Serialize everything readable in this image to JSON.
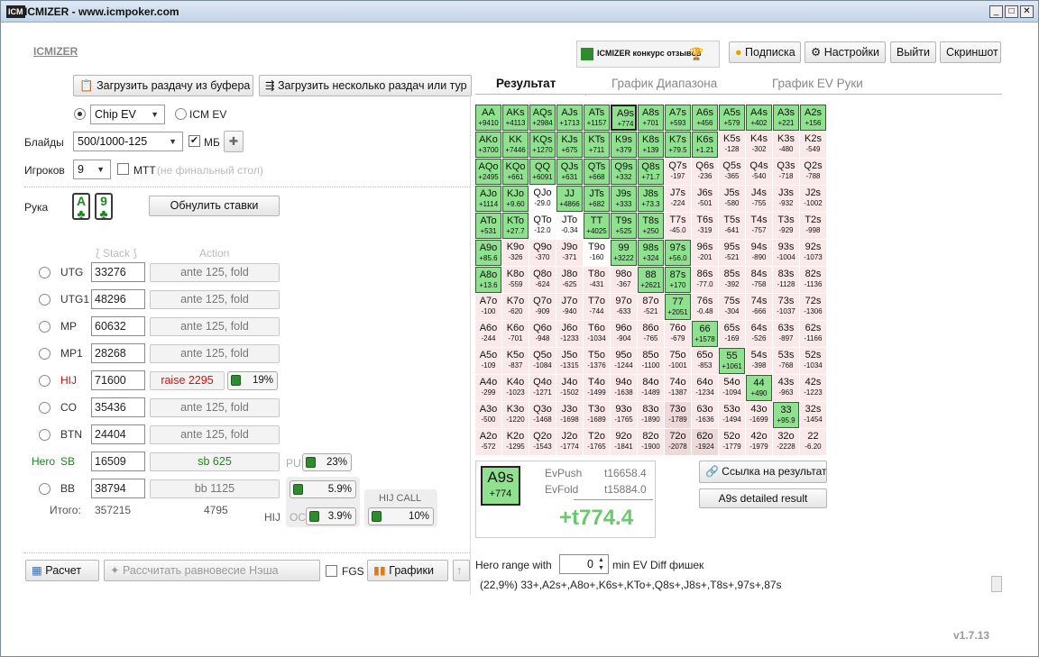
{
  "window": {
    "title": "ICMIZER - www.icmpoker.com",
    "icon_text": "ICM"
  },
  "header": {
    "brand": "ICMIZER",
    "promo": "ICMIZER конкурс отзывов",
    "subscribe": "Подписка",
    "settings": "Настройки",
    "exit": "Выйти",
    "screenshot": "Скриншот"
  },
  "load": {
    "from_clipboard": "Загрузить раздачу из буфера",
    "load_multiple": "Загрузить несколько раздач или тур"
  },
  "model": {
    "chip_ev": "Chip EV",
    "icm_ev": "ICM EV",
    "selected": "Chip EV"
  },
  "blinds": {
    "label": "Блайды",
    "value": "500/1000-125",
    "mb_label": "МБ"
  },
  "players": {
    "label": "Игроков",
    "value": "9",
    "mtt_label": "МТТ",
    "note": "(не финальный стол)"
  },
  "hand": {
    "label": "Рука",
    "card1": "A",
    "card2": "9",
    "reset": "Обнулить ставки"
  },
  "table_head": {
    "stack": "Stack",
    "action": "Action"
  },
  "seats": [
    {
      "pos": "UTG",
      "stack": "33276",
      "action": "ante 125, fold"
    },
    {
      "pos": "UTG1",
      "stack": "48296",
      "action": "ante 125, fold"
    },
    {
      "pos": "MP",
      "stack": "60632",
      "action": "ante 125, fold"
    },
    {
      "pos": "MP1",
      "stack": "28268",
      "action": "ante 125, fold"
    },
    {
      "pos": "HIJ",
      "stack": "71600",
      "action": "raise 2295",
      "pct": "19%"
    },
    {
      "pos": "CO",
      "stack": "35436",
      "action": "ante 125, fold"
    },
    {
      "pos": "BTN",
      "stack": "24404",
      "action": "ante 125, fold"
    },
    {
      "pos": "SB",
      "hero": "Hero",
      "stack": "16509",
      "action": "sb 625"
    },
    {
      "pos": "BB",
      "stack": "38794",
      "action": "bb 1125"
    }
  ],
  "totals": {
    "label": "Итого:",
    "stack": "357215",
    "pot": "4795"
  },
  "ranges": {
    "pu_label": "PU",
    "pu_pct": "23%",
    "bb_pct": "5.9%",
    "hij_label": "HIJ",
    "oc_label": "OC",
    "oc_pct": "3.9%",
    "hij_call_label": "HIJ CALL",
    "hij_call_pct": "10%"
  },
  "bottom": {
    "calc": "Расчет",
    "nash": "Рассчитать равновесие Нэша",
    "fgs": "FGS",
    "charts": "Графики"
  },
  "result": {
    "tab_result": "Результат",
    "tab_range": "График Диапазона",
    "tab_ev": "График EV Руки",
    "hand": "A9s",
    "hand_ev": "+774",
    "evpush_label": "EvPush",
    "evpush": "t16658.4",
    "evfold_label": "EvFold",
    "evfold": "t15884.0",
    "diff": "+t774.4",
    "link": "Ссылка на результат",
    "detail": "A9s detailed result",
    "range_with": "Hero range with",
    "min_ev": "0",
    "min_ev_label": "min EV Diff фишек",
    "range_text": "(22,9%) 33+,A2s+,A8o+,K6s+,KTo+,Q8s+,J8s+,T8s+,97s+,87s"
  },
  "version": "v1.7.13",
  "grid": [
    [
      [
        "AA",
        "+9410",
        "g"
      ],
      [
        "AKs",
        "+4113",
        "g"
      ],
      [
        "AQs",
        "+2984",
        "g"
      ],
      [
        "AJs",
        "+1713",
        "g"
      ],
      [
        "ATs",
        "+1157",
        "g"
      ],
      [
        "A9s",
        "+774",
        "gs"
      ],
      [
        "A8s",
        "+701",
        "g"
      ],
      [
        "A7s",
        "+593",
        "g"
      ],
      [
        "A6s",
        "+456",
        "g"
      ],
      [
        "A5s",
        "+579",
        "g"
      ],
      [
        "A4s",
        "+402",
        "g"
      ],
      [
        "A3s",
        "+221",
        "g"
      ],
      [
        "A2s",
        "+156",
        "g"
      ]
    ],
    [
      [
        "AKo",
        "+3700",
        "g"
      ],
      [
        "KK",
        "+7446",
        "g"
      ],
      [
        "KQs",
        "+1270",
        "g"
      ],
      [
        "KJs",
        "+675",
        "g"
      ],
      [
        "KTs",
        "+711",
        "g"
      ],
      [
        "K9s",
        "+379",
        "g"
      ],
      [
        "K8s",
        "+139",
        "g"
      ],
      [
        "K7s",
        "+79.5",
        "g"
      ],
      [
        "K6s",
        "+1.21",
        "g"
      ],
      [
        "K5s",
        "-128",
        "r"
      ],
      [
        "K4s",
        "-302",
        "r"
      ],
      [
        "K3s",
        "-480",
        "r"
      ],
      [
        "K2s",
        "-549",
        "r"
      ]
    ],
    [
      [
        "AQo",
        "+2495",
        "g"
      ],
      [
        "KQo",
        "+661",
        "g"
      ],
      [
        "QQ",
        "+6091",
        "g"
      ],
      [
        "QJs",
        "+631",
        "g"
      ],
      [
        "QTs",
        "+668",
        "g"
      ],
      [
        "Q9s",
        "+332",
        "g"
      ],
      [
        "Q8s",
        "+71.7",
        "g"
      ],
      [
        "Q7s",
        "-197",
        "r"
      ],
      [
        "Q6s",
        "-236",
        "r"
      ],
      [
        "Q5s",
        "-365",
        "r"
      ],
      [
        "Q4s",
        "-540",
        "r"
      ],
      [
        "Q3s",
        "-718",
        "r"
      ],
      [
        "Q2s",
        "-788",
        "r"
      ]
    ],
    [
      [
        "AJo",
        "+1114",
        "g"
      ],
      [
        "KJo",
        "+9.60",
        "g"
      ],
      [
        "QJo",
        "-29.0",
        "w"
      ],
      [
        "JJ",
        "+4866",
        "g"
      ],
      [
        "JTs",
        "+682",
        "g"
      ],
      [
        "J9s",
        "+333",
        "g"
      ],
      [
        "J8s",
        "+73.3",
        "g"
      ],
      [
        "J7s",
        "-224",
        "r"
      ],
      [
        "J6s",
        "-501",
        "r"
      ],
      [
        "J5s",
        "-580",
        "r"
      ],
      [
        "J4s",
        "-755",
        "r"
      ],
      [
        "J3s",
        "-932",
        "r"
      ],
      [
        "J2s",
        "-1002",
        "r"
      ]
    ],
    [
      [
        "ATo",
        "+531",
        "g"
      ],
      [
        "KTo",
        "+27.7",
        "g"
      ],
      [
        "QTo",
        "-12.0",
        "w"
      ],
      [
        "JTo",
        "-0.34",
        "w"
      ],
      [
        "TT",
        "+4025",
        "g"
      ],
      [
        "T9s",
        "+525",
        "g"
      ],
      [
        "T8s",
        "+250",
        "g"
      ],
      [
        "T7s",
        "-45.0",
        "r"
      ],
      [
        "T6s",
        "-319",
        "r"
      ],
      [
        "T5s",
        "-641",
        "r"
      ],
      [
        "T4s",
        "-757",
        "r"
      ],
      [
        "T3s",
        "-929",
        "r"
      ],
      [
        "T2s",
        "-998",
        "r"
      ]
    ],
    [
      [
        "A9o",
        "+85.6",
        "g"
      ],
      [
        "K9o",
        "-326",
        "r"
      ],
      [
        "Q9o",
        "-370",
        "r"
      ],
      [
        "J9o",
        "-371",
        "r"
      ],
      [
        "T9o",
        "-160",
        "w"
      ],
      [
        "99",
        "+3222",
        "g"
      ],
      [
        "98s",
        "+324",
        "g"
      ],
      [
        "97s",
        "+56.0",
        "g"
      ],
      [
        "96s",
        "-201",
        "r"
      ],
      [
        "95s",
        "-521",
        "r"
      ],
      [
        "94s",
        "-890",
        "r"
      ],
      [
        "93s",
        "-1004",
        "r"
      ],
      [
        "92s",
        "-1073",
        "r"
      ]
    ],
    [
      [
        "A8o",
        "+13.6",
        "g"
      ],
      [
        "K8o",
        "-559",
        "r"
      ],
      [
        "Q8o",
        "-624",
        "r"
      ],
      [
        "J8o",
        "-625",
        "r"
      ],
      [
        "T8o",
        "-431",
        "r"
      ],
      [
        "98o",
        "-367",
        "r"
      ],
      [
        "88",
        "+2621",
        "g"
      ],
      [
        "87s",
        "+170",
        "g"
      ],
      [
        "86s",
        "-77.0",
        "r"
      ],
      [
        "85s",
        "-392",
        "r"
      ],
      [
        "84s",
        "-758",
        "r"
      ],
      [
        "83s",
        "-1128",
        "r"
      ],
      [
        "82s",
        "-1136",
        "r"
      ]
    ],
    [
      [
        "A7o",
        "-100",
        "r"
      ],
      [
        "K7o",
        "-620",
        "r"
      ],
      [
        "Q7o",
        "-909",
        "r"
      ],
      [
        "J7o",
        "-940",
        "r"
      ],
      [
        "T7o",
        "-744",
        "r"
      ],
      [
        "97o",
        "-633",
        "r"
      ],
      [
        "87o",
        "-521",
        "r"
      ],
      [
        "77",
        "+2051",
        "g"
      ],
      [
        "76s",
        "-0.48",
        "r"
      ],
      [
        "75s",
        "-304",
        "r"
      ],
      [
        "74s",
        "-666",
        "r"
      ],
      [
        "73s",
        "-1037",
        "r"
      ],
      [
        "72s",
        "-1306",
        "r"
      ]
    ],
    [
      [
        "A6o",
        "-244",
        "r"
      ],
      [
        "K6o",
        "-701",
        "r"
      ],
      [
        "Q6o",
        "-948",
        "r"
      ],
      [
        "J6o",
        "-1233",
        "r"
      ],
      [
        "T6o",
        "-1034",
        "r"
      ],
      [
        "96o",
        "-904",
        "r"
      ],
      [
        "86o",
        "-765",
        "r"
      ],
      [
        "76o",
        "-679",
        "r"
      ],
      [
        "66",
        "+1578",
        "g"
      ],
      [
        "65s",
        "-169",
        "r"
      ],
      [
        "64s",
        "-526",
        "r"
      ],
      [
        "63s",
        "-897",
        "r"
      ],
      [
        "62s",
        "-1166",
        "r"
      ]
    ],
    [
      [
        "A5o",
        "-109",
        "r"
      ],
      [
        "K5o",
        "-837",
        "r"
      ],
      [
        "Q5o",
        "-1084",
        "r"
      ],
      [
        "J5o",
        "-1315",
        "r"
      ],
      [
        "T5o",
        "-1376",
        "r"
      ],
      [
        "95o",
        "-1244",
        "r"
      ],
      [
        "85o",
        "-1100",
        "r"
      ],
      [
        "75o",
        "-1001",
        "r"
      ],
      [
        "65o",
        "-853",
        "r"
      ],
      [
        "55",
        "+1061",
        "g"
      ],
      [
        "54s",
        "-398",
        "r"
      ],
      [
        "53s",
        "-768",
        "r"
      ],
      [
        "52s",
        "-1034",
        "r"
      ]
    ],
    [
      [
        "A4o",
        "-299",
        "r"
      ],
      [
        "K4o",
        "-1023",
        "r"
      ],
      [
        "Q4o",
        "-1271",
        "r"
      ],
      [
        "J4o",
        "-1502",
        "r"
      ],
      [
        "T4o",
        "-1499",
        "r"
      ],
      [
        "94o",
        "-1638",
        "r"
      ],
      [
        "84o",
        "-1489",
        "r"
      ],
      [
        "74o",
        "-1387",
        "r"
      ],
      [
        "64o",
        "-1234",
        "r"
      ],
      [
        "54o",
        "-1094",
        "r"
      ],
      [
        "44",
        "+490",
        "g"
      ],
      [
        "43s",
        "-963",
        "r"
      ],
      [
        "42s",
        "-1223",
        "r"
      ]
    ],
    [
      [
        "A3o",
        "-500",
        "r"
      ],
      [
        "K3o",
        "-1220",
        "r"
      ],
      [
        "Q3o",
        "-1468",
        "r"
      ],
      [
        "J3o",
        "-1698",
        "r"
      ],
      [
        "T3o",
        "-1689",
        "r"
      ],
      [
        "93o",
        "-1765",
        "r"
      ],
      [
        "83o",
        "-1890",
        "r"
      ],
      [
        "73o",
        "-1789",
        "r2"
      ],
      [
        "63o",
        "-1636",
        "r"
      ],
      [
        "53o",
        "-1494",
        "r"
      ],
      [
        "43o",
        "-1699",
        "r"
      ],
      [
        "33",
        "+95.9",
        "g"
      ],
      [
        "32s",
        "-1454",
        "r"
      ]
    ],
    [
      [
        "A2o",
        "-572",
        "r"
      ],
      [
        "K2o",
        "-1295",
        "r"
      ],
      [
        "Q2o",
        "-1543",
        "r"
      ],
      [
        "J2o",
        "-1774",
        "r"
      ],
      [
        "T2o",
        "-1765",
        "r"
      ],
      [
        "92o",
        "-1841",
        "r"
      ],
      [
        "82o",
        "-1900",
        "r"
      ],
      [
        "72o",
        "-2078",
        "r2"
      ],
      [
        "62o",
        "-1924",
        "r2"
      ],
      [
        "52o",
        "-1779",
        "r"
      ],
      [
        "42o",
        "-1979",
        "r"
      ],
      [
        "32o",
        "-2228",
        "r"
      ],
      [
        "22",
        "-6.20",
        "r"
      ]
    ]
  ]
}
